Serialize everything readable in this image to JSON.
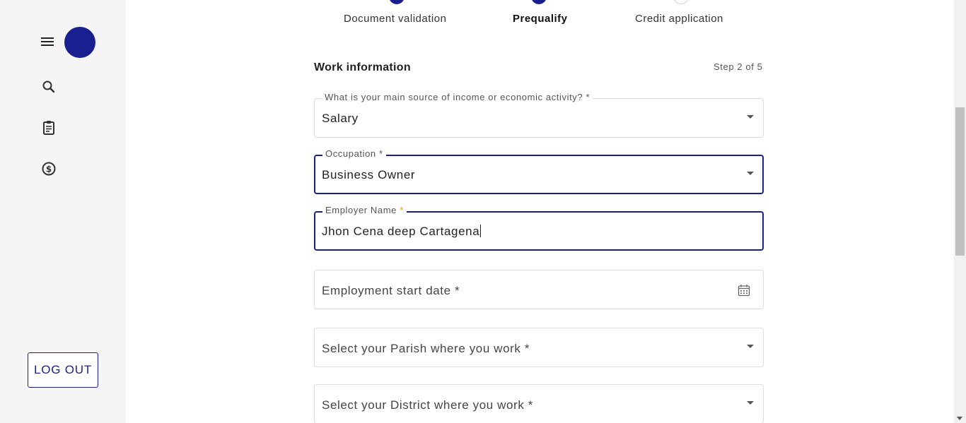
{
  "sidebar": {
    "nav_icons": [
      "menu-icon",
      "search-icon",
      "clipboard-icon",
      "dollar-icon"
    ],
    "logout_label": "LOG OUT"
  },
  "stepper": {
    "steps": [
      {
        "label": "Document validation",
        "state": "completed"
      },
      {
        "label": "Prequalify",
        "state": "active"
      },
      {
        "label": "Credit application",
        "state": "pending"
      }
    ]
  },
  "form": {
    "section_title": "Work information",
    "step_count": "Step 2 of 5",
    "income_source": {
      "label": "What is your main source of income or economic activity? *",
      "value": "Salary"
    },
    "occupation": {
      "label": "Occupation *",
      "value": "Business Owner"
    },
    "employer_name": {
      "label": "Employer Name",
      "required_mark": "*",
      "value": "Jhon Cena deep Cartagena"
    },
    "employment_start_date": {
      "placeholder": "Employment start date *"
    },
    "parish": {
      "placeholder": "Select your Parish where you work *"
    },
    "district": {
      "placeholder": "Select your District where you work *"
    }
  },
  "colors": {
    "primary": "#1a1f8f",
    "sidebar_bg": "#f5f5f5",
    "border": "#dcdcdc",
    "required_star": "#e0a800"
  }
}
